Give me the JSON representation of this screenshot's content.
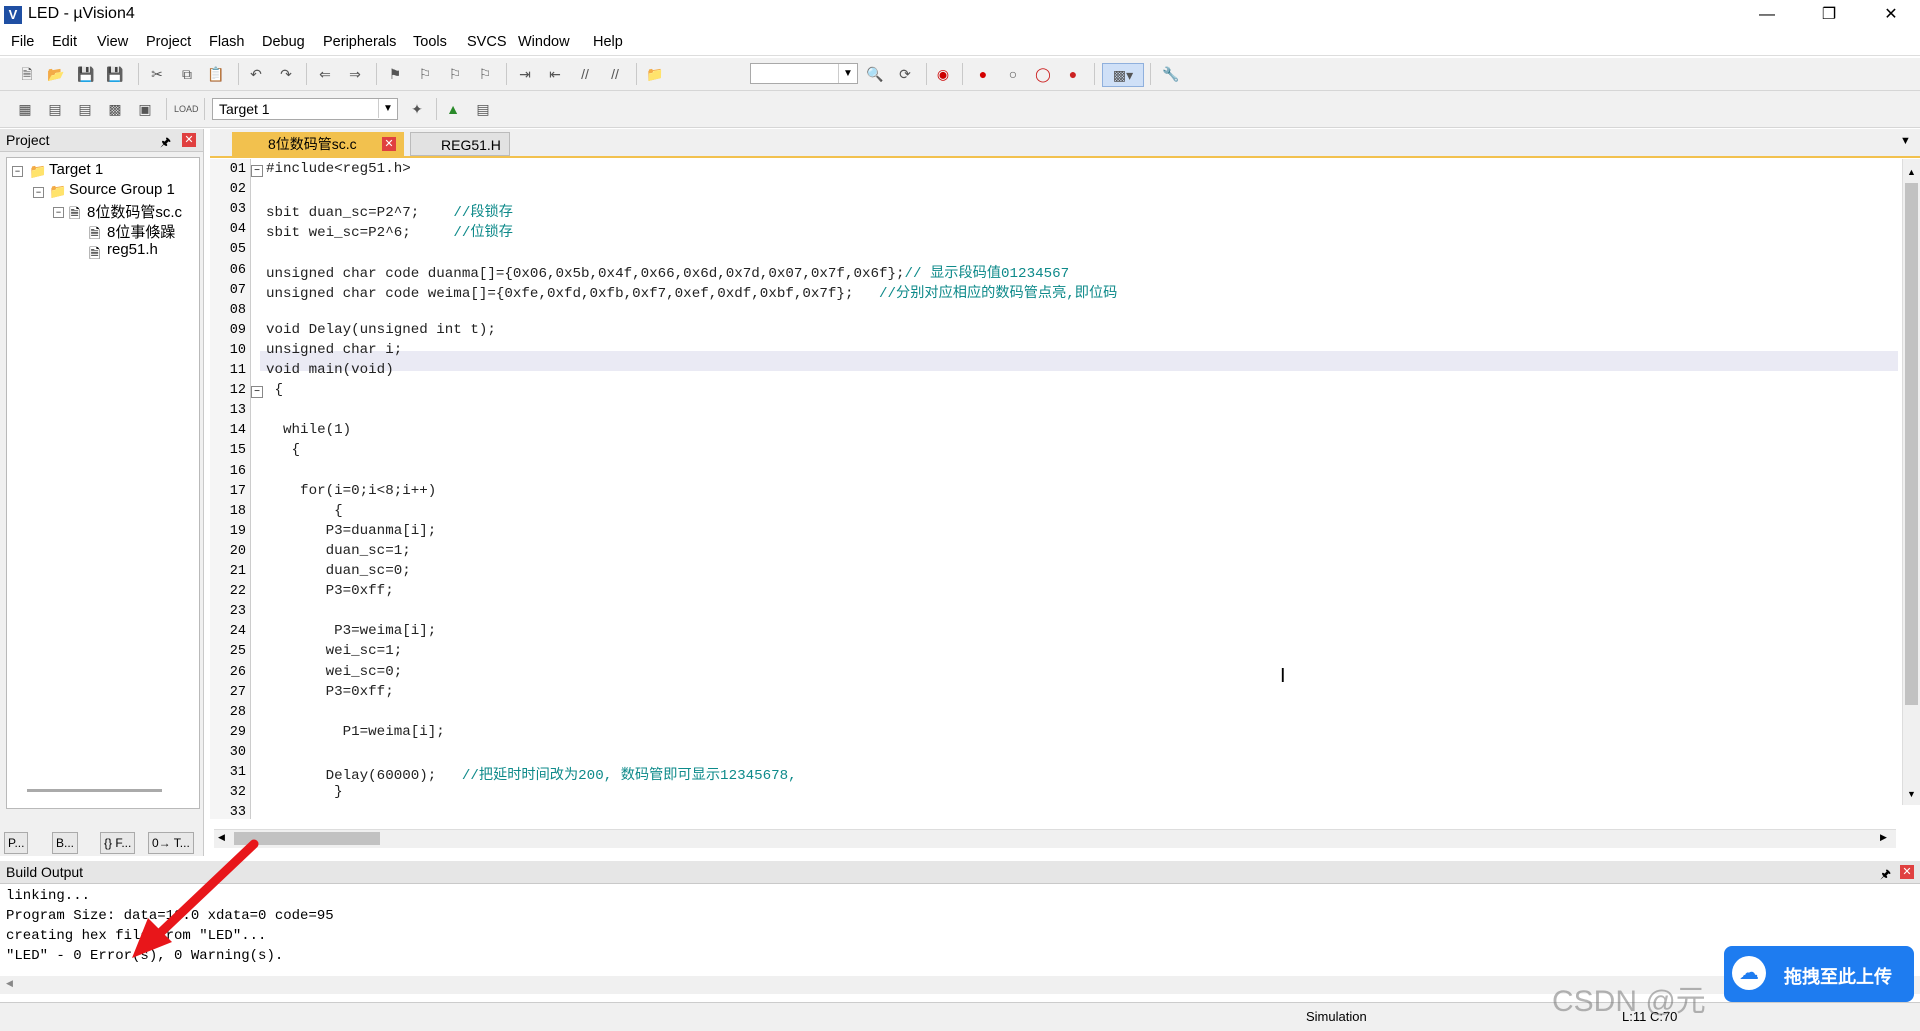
{
  "window": {
    "title": "LED  - µVision4",
    "app_icon": "V",
    "controls": [
      "minimize-icon",
      "restore-icon",
      "close-icon"
    ]
  },
  "menu": [
    "File",
    "Edit",
    "View",
    "Project",
    "Flash",
    "Debug",
    "Peripherals",
    "Tools",
    "SVCS",
    "Window",
    "Help"
  ],
  "toolbar2": {
    "target_select": "Target 1"
  },
  "project_panel": {
    "title": "Project",
    "tree": [
      {
        "label": "Target 1"
      },
      {
        "label": "Source Group 1"
      },
      {
        "label": "8位数码管sc.c"
      },
      {
        "label": "8位事倏躁"
      },
      {
        "label": "reg51.h"
      }
    ],
    "tabs": [
      "P...",
      "B...",
      "{} F...",
      "0→ T..."
    ]
  },
  "editor": {
    "tabs": [
      {
        "label": "8位数码管sc.c",
        "active": true
      },
      {
        "label": "REG51.H",
        "active": false
      }
    ],
    "lines": [
      {
        "n": "01",
        "code": "#include<reg51.h>"
      },
      {
        "n": "02",
        "code": ""
      },
      {
        "n": "03",
        "code": "sbit duan_sc=P2^7;    ",
        "comment": "//段锁存"
      },
      {
        "n": "04",
        "code": "sbit wei_sc=P2^6;     ",
        "comment": "//位锁存"
      },
      {
        "n": "05",
        "code": ""
      },
      {
        "n": "06",
        "code": "unsigned char code duanma[]={0x06,0x5b,0x4f,0x66,0x6d,0x7d,0x07,0x7f,0x6f};",
        "comment": "// 显示段码值01234567"
      },
      {
        "n": "07",
        "code": "unsigned char code weima[]={0xfe,0xfd,0xfb,0xf7,0xef,0xdf,0xbf,0x7f};   ",
        "comment": "//分别对应相应的数码管点亮,即位码"
      },
      {
        "n": "08",
        "code": ""
      },
      {
        "n": "09",
        "code": "void Delay(unsigned int t);"
      },
      {
        "n": "10",
        "code": "unsigned char i;"
      },
      {
        "n": "11",
        "code": "void main(void)"
      },
      {
        "n": "12",
        "code": " {"
      },
      {
        "n": "13",
        "code": ""
      },
      {
        "n": "14",
        "code": "  while(1)"
      },
      {
        "n": "15",
        "code": "   {"
      },
      {
        "n": "16",
        "code": ""
      },
      {
        "n": "17",
        "code": "    for(i=0;i<8;i++)"
      },
      {
        "n": "18",
        "code": "        {"
      },
      {
        "n": "19",
        "code": "       P3=duanma[i];"
      },
      {
        "n": "20",
        "code": "       duan_sc=1;"
      },
      {
        "n": "21",
        "code": "       duan_sc=0;"
      },
      {
        "n": "22",
        "code": "       P3=0xff;"
      },
      {
        "n": "23",
        "code": ""
      },
      {
        "n": "24",
        "code": "        P3=weima[i];"
      },
      {
        "n": "25",
        "code": "       wei_sc=1;"
      },
      {
        "n": "26",
        "code": "       wei_sc=0;"
      },
      {
        "n": "27",
        "code": "       P3=0xff;"
      },
      {
        "n": "28",
        "code": ""
      },
      {
        "n": "29",
        "code": "         P1=weima[i];"
      },
      {
        "n": "30",
        "code": ""
      },
      {
        "n": "31",
        "code": "       Delay(60000);   ",
        "comment": "//把延时时间改为200, 数码管即可显示12345678,"
      },
      {
        "n": "32",
        "code": "        }"
      },
      {
        "n": "33",
        "code": ""
      }
    ]
  },
  "build_output": {
    "title": "Build Output",
    "lines": [
      "linking...",
      "Program Size: data=10.0 xdata=0 code=95",
      "creating hex file from \"LED\"...",
      "\"LED\" - 0 Error(s), 0 Warning(s)."
    ]
  },
  "status": {
    "mode": "Simulation",
    "position": "L:11 C:70"
  },
  "overlay": {
    "upload_text": "拖拽至此上传",
    "watermark": "CSDN @元"
  },
  "colors": {
    "comment": "#0e8a8a",
    "active_tab": "#f2c14e",
    "arrow": "#e8161a",
    "upload": "#1e7cf0"
  }
}
